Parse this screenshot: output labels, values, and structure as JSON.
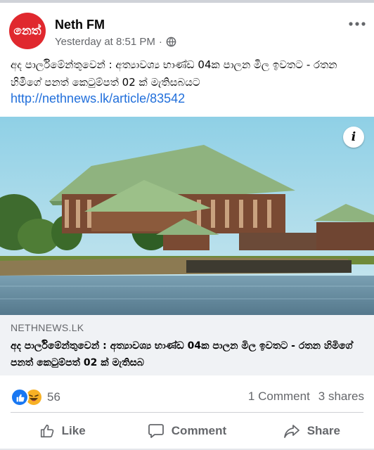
{
  "post": {
    "page_name": "Neth FM",
    "avatar_text": "නෙත්",
    "timestamp": "Yesterday at 8:51 PM",
    "separator": "·",
    "privacy_icon": "globe-icon",
    "more_icon": "ellipsis-icon",
    "text": "අද පාර්ලිමේන්තුවෙන් : අත්‍යාවශ්‍ය භාණ්ඩ 04ක පාලන මිල ඉවතට - රතන හිමිගේ පනත් කෙටුම්පත් 02 ක් මැතිසබයට",
    "link": "http://nethnews.lk/article/83542"
  },
  "link_preview": {
    "info_icon": "info-icon",
    "domain": "NETHNEWS.LK",
    "title": "අද පාර්ලිමේන්තුවෙන් : අත්‍යාවශ්‍ය භාණ්ඩ 04ක පාලන මිල ඉවතට - රතන හිමිගේ පනත් කෙටුම්පත් 02 ක් මැතිසබ"
  },
  "stats": {
    "reaction_icons": [
      "like-reaction-icon",
      "haha-reaction-icon"
    ],
    "reaction_count": "56",
    "comments": "1 Comment",
    "shares": "3 shares"
  },
  "actions": {
    "like": "Like",
    "comment": "Comment",
    "share": "Share"
  },
  "colors": {
    "avatar_bg": "#e0282e",
    "link": "#216fdb",
    "muted": "#65676b",
    "like_blue": "#1877f2",
    "haha_yellow": "#f7b125"
  }
}
